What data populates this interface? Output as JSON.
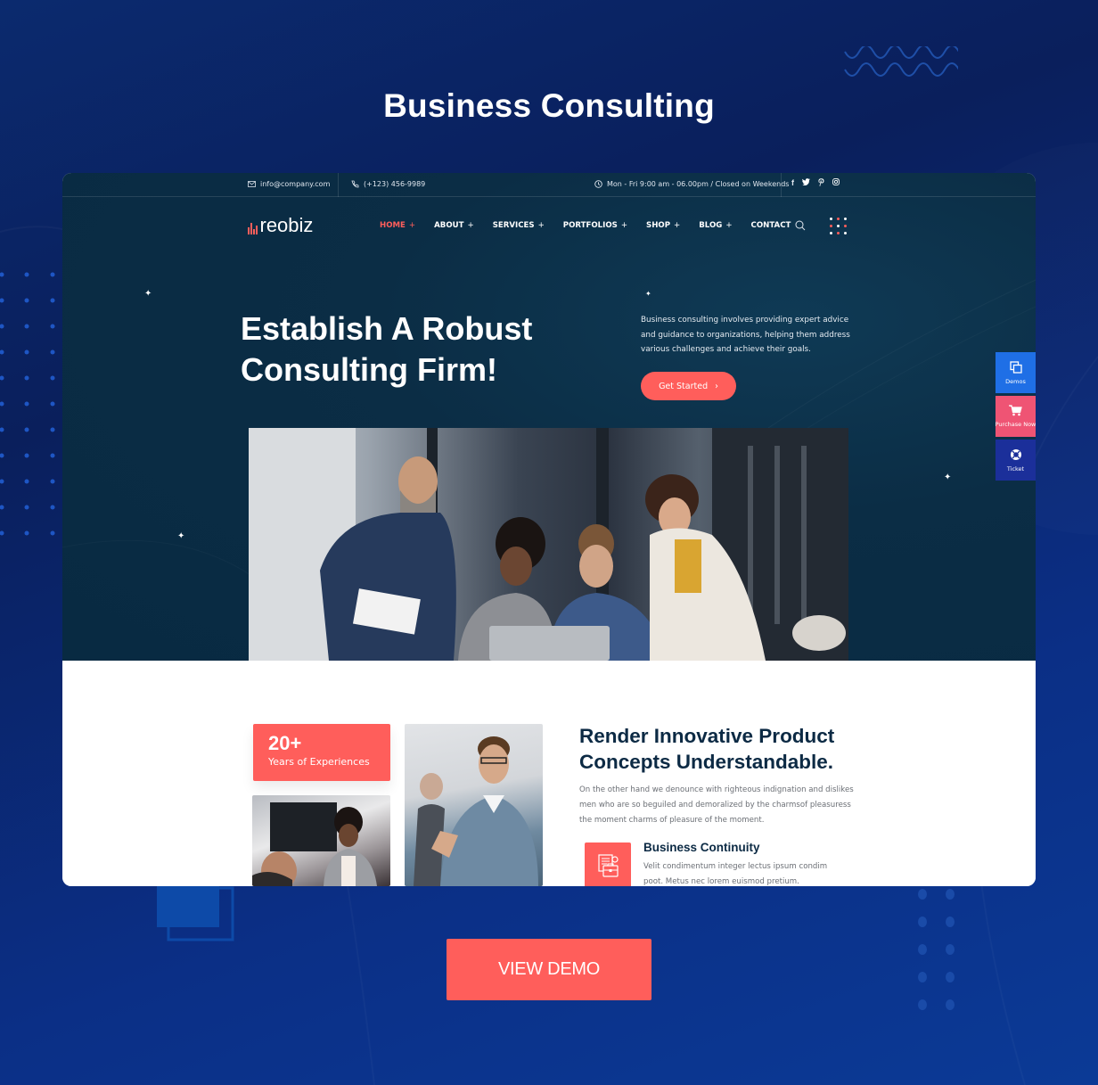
{
  "promo": {
    "title": "Business Consulting",
    "view_demo_label": "VIEW DEMO"
  },
  "topbar": {
    "email": "info@company.com",
    "phone": "(+123) 456-9989",
    "hours": "Mon - Fri 9:00 am - 06.00pm / Closed on Weekends",
    "social": [
      {
        "icon": "facebook-icon",
        "glyph": "f"
      },
      {
        "icon": "twitter-icon",
        "glyph": "t"
      },
      {
        "icon": "pinterest-icon",
        "glyph": "p"
      },
      {
        "icon": "instagram-icon",
        "glyph": "i"
      }
    ]
  },
  "nav": {
    "logo": "reobiz",
    "items": [
      {
        "label": "HOME",
        "plus": "+",
        "active": true
      },
      {
        "label": "ABOUT",
        "plus": "+"
      },
      {
        "label": "SERVICES",
        "plus": "+"
      },
      {
        "label": "PORTFOLIOS",
        "plus": "+"
      },
      {
        "label": "SHOP",
        "plus": "+"
      },
      {
        "label": "BLOG",
        "plus": "+"
      },
      {
        "label": "CONTACT",
        "plus": ""
      }
    ]
  },
  "hero": {
    "title_line1": "Establish A Robust",
    "title_line2": "Consulting Firm!",
    "description": "Business consulting involves providing expert advice and guidance to organizations, helping them address various challenges and achieve their goals.",
    "cta_label": "Get Started",
    "cta_arrow": "›"
  },
  "side_widget": {
    "items": [
      {
        "label": "Demos",
        "icon": "copy-icon",
        "color": "#1f6fe6"
      },
      {
        "label": "Purchase Now",
        "icon": "cart-icon",
        "color": "#ef5474"
      },
      {
        "label": "Ticket",
        "icon": "lifebuoy-icon",
        "color": "#1b2f9a"
      }
    ]
  },
  "about": {
    "experience_number": "20+",
    "experience_label": "Years of Experiences",
    "title": "Render Innovative Product Concepts Understandable.",
    "description": "On the other hand we denounce with righteous indignation and dislikes men who are so beguiled and demoralized by the charmsof pleasuress the moment charms of pleasure of the moment.",
    "feature": {
      "title": "Business Continuity",
      "description": "Velit condimentum integer lectus ipsum condim poot. Metus nec lorem euismod pretium."
    }
  },
  "colors": {
    "accent": "#ff5e5b",
    "hero_bg": "#0b2d45",
    "heading_dark": "#0c2a44",
    "page_bg": "#0b2a6e"
  }
}
